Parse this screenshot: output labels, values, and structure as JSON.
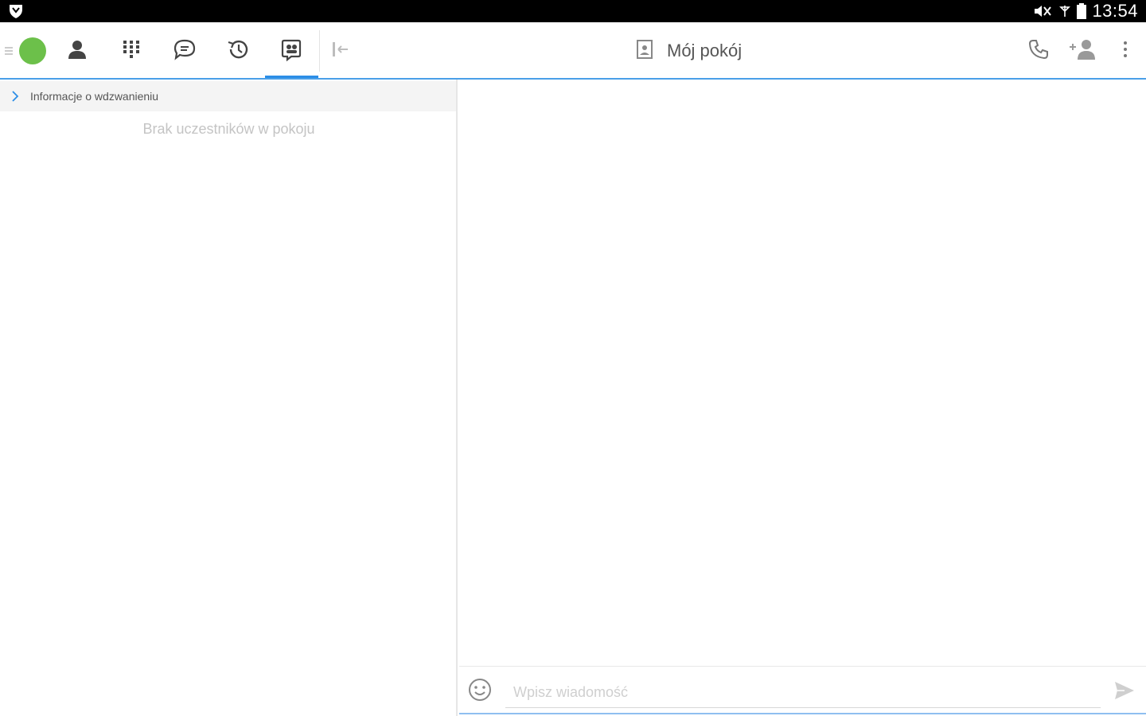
{
  "status_bar": {
    "time": "13:54",
    "icons": [
      "shield-app-icon",
      "mute-icon",
      "no-signal-icon",
      "battery-icon"
    ]
  },
  "toolbar": {
    "tabs": [
      {
        "icon": "contact-person-icon"
      },
      {
        "icon": "dialpad-icon"
      },
      {
        "icon": "chat-bubble-icon"
      },
      {
        "icon": "history-clock-icon"
      },
      {
        "icon": "meeting-room-icon",
        "active": true
      }
    ],
    "collapse_icon": "collapse-panel-icon",
    "room_title": "Mój pokój",
    "right_icons": [
      "phone-icon",
      "add-participant-icon",
      "more-vert-icon"
    ]
  },
  "left_panel": {
    "call_info_label": "Informacje o wdzwanieniu",
    "empty_message": "Brak uczestników w pokoju"
  },
  "composer": {
    "placeholder": "Wpisz wiadomość",
    "value": ""
  },
  "colors": {
    "accent": "#2b8de6",
    "presence": "#6cc04a",
    "status_bar_bg": "#000000"
  }
}
